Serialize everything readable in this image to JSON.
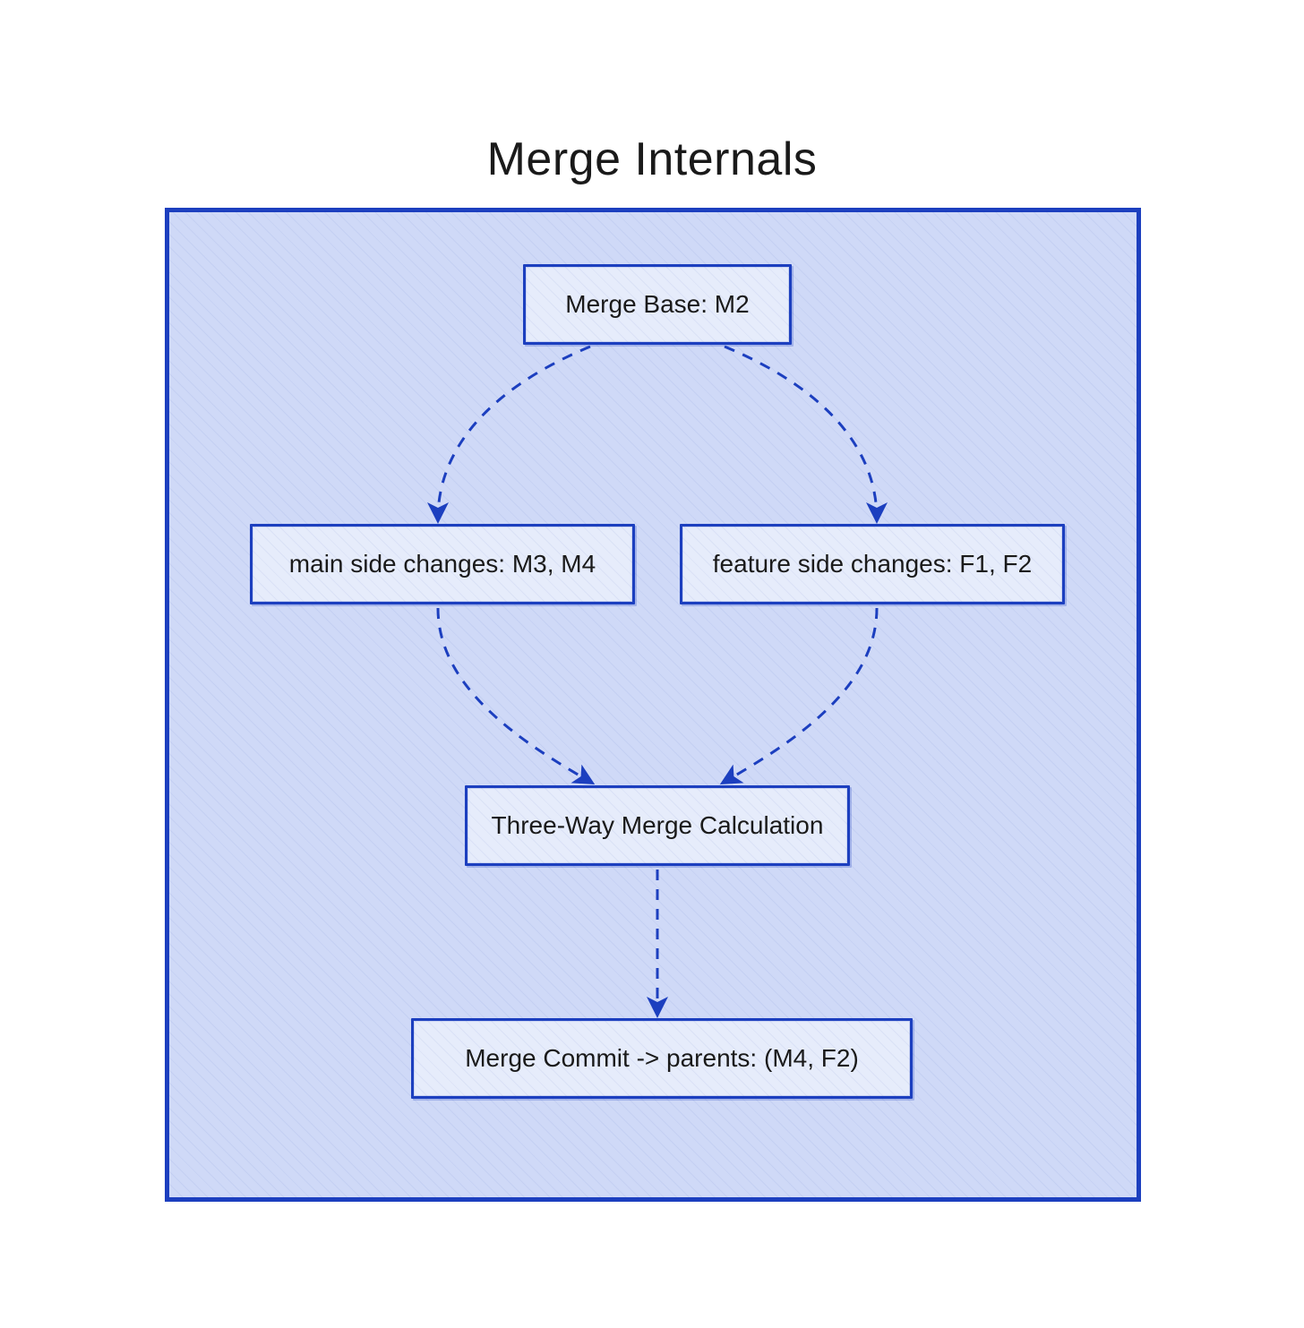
{
  "diagram": {
    "title": "Merge Internals",
    "nodes": {
      "merge_base": "Merge Base: M2",
      "main_side": "main side changes: M3, M4",
      "feature_side": "feature side changes: F1, F2",
      "calc": "Three-Way Merge Calculation",
      "commit": "Merge Commit -> parents: (M4, F2)"
    },
    "edges": [
      {
        "from": "merge_base",
        "to": "main_side",
        "style": "dashed"
      },
      {
        "from": "merge_base",
        "to": "feature_side",
        "style": "dashed"
      },
      {
        "from": "main_side",
        "to": "calc",
        "style": "dashed"
      },
      {
        "from": "feature_side",
        "to": "calc",
        "style": "dashed"
      },
      {
        "from": "calc",
        "to": "commit",
        "style": "dashed"
      }
    ],
    "style": {
      "stroke": "#1c3fbf",
      "fill_outer": "#cfd9f7",
      "fill_node": "#e6ecfb"
    }
  }
}
